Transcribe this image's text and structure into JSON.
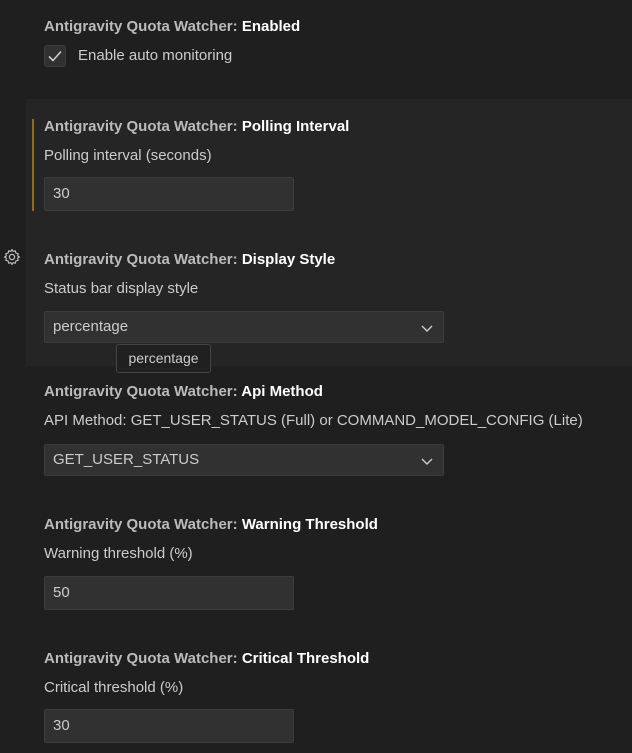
{
  "category_prefix": "Antigravity Quota Watcher:",
  "settings": {
    "enabled": {
      "title": "Enabled",
      "checkbox_label": "Enable auto monitoring",
      "checked": true
    },
    "polling_interval": {
      "title": "Polling Interval",
      "description": "Polling interval (seconds)",
      "value": "30"
    },
    "display_style": {
      "title": "Display Style",
      "description": "Status bar display style",
      "value": "percentage",
      "tooltip": "percentage"
    },
    "api_method": {
      "title": "Api Method",
      "description": "API Method: GET_USER_STATUS (Full) or COMMAND_MODEL_CONFIG (Lite)",
      "value": "GET_USER_STATUS"
    },
    "warning_threshold": {
      "title": "Warning Threshold",
      "description": "Warning threshold (%)",
      "value": "50"
    },
    "critical_threshold": {
      "title": "Critical Threshold",
      "description": "Critical threshold (%)",
      "value": "30"
    }
  },
  "icons": {
    "gear": "gear-icon",
    "check": "check-icon",
    "chevron": "chevron-down-icon"
  },
  "colors": {
    "background": "#1f1f1f",
    "modified_indicator": "#8c6c1f"
  }
}
